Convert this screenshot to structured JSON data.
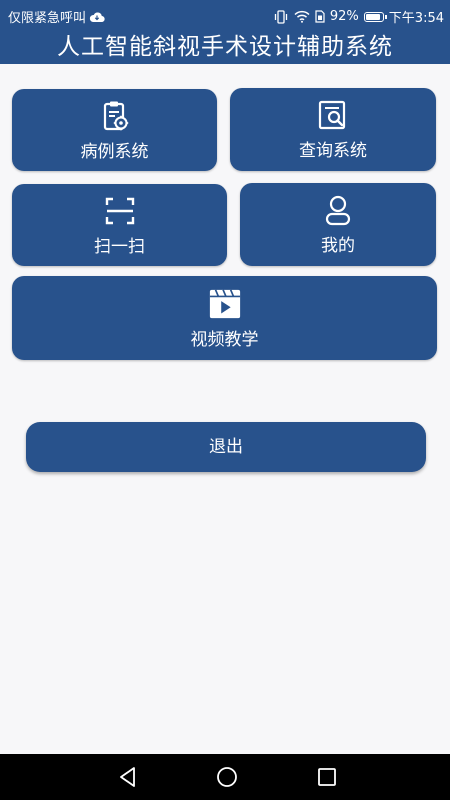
{
  "status_bar": {
    "carrier_text": "仅限紧急呼叫",
    "battery_percent": "92%",
    "time": "下午3:54",
    "icons": [
      "cloud-icon",
      "vibrate-icon",
      "wifi-icon",
      "sim-icon",
      "battery-icon"
    ]
  },
  "header": {
    "title": "人工智能斜视手术设计辅助系统"
  },
  "menu": {
    "cases": {
      "label": "病例系统",
      "icon": "clipboard-gear-icon"
    },
    "query": {
      "label": "查询系统",
      "icon": "document-search-icon"
    },
    "scan": {
      "label": "扫一扫",
      "icon": "scan-frame-icon"
    },
    "mine": {
      "label": "我的",
      "icon": "user-icon"
    },
    "video": {
      "label": "视频教学",
      "icon": "video-play-icon"
    }
  },
  "logout": {
    "label": "退出"
  },
  "nav_bar": {
    "icons": [
      "back-triangle-icon",
      "home-circle-icon",
      "recent-square-icon"
    ]
  },
  "colors": {
    "primary": "#28528c",
    "background": "#f7f7f9",
    "text_on_primary": "#ffffff",
    "nav_bar": "#000000"
  }
}
